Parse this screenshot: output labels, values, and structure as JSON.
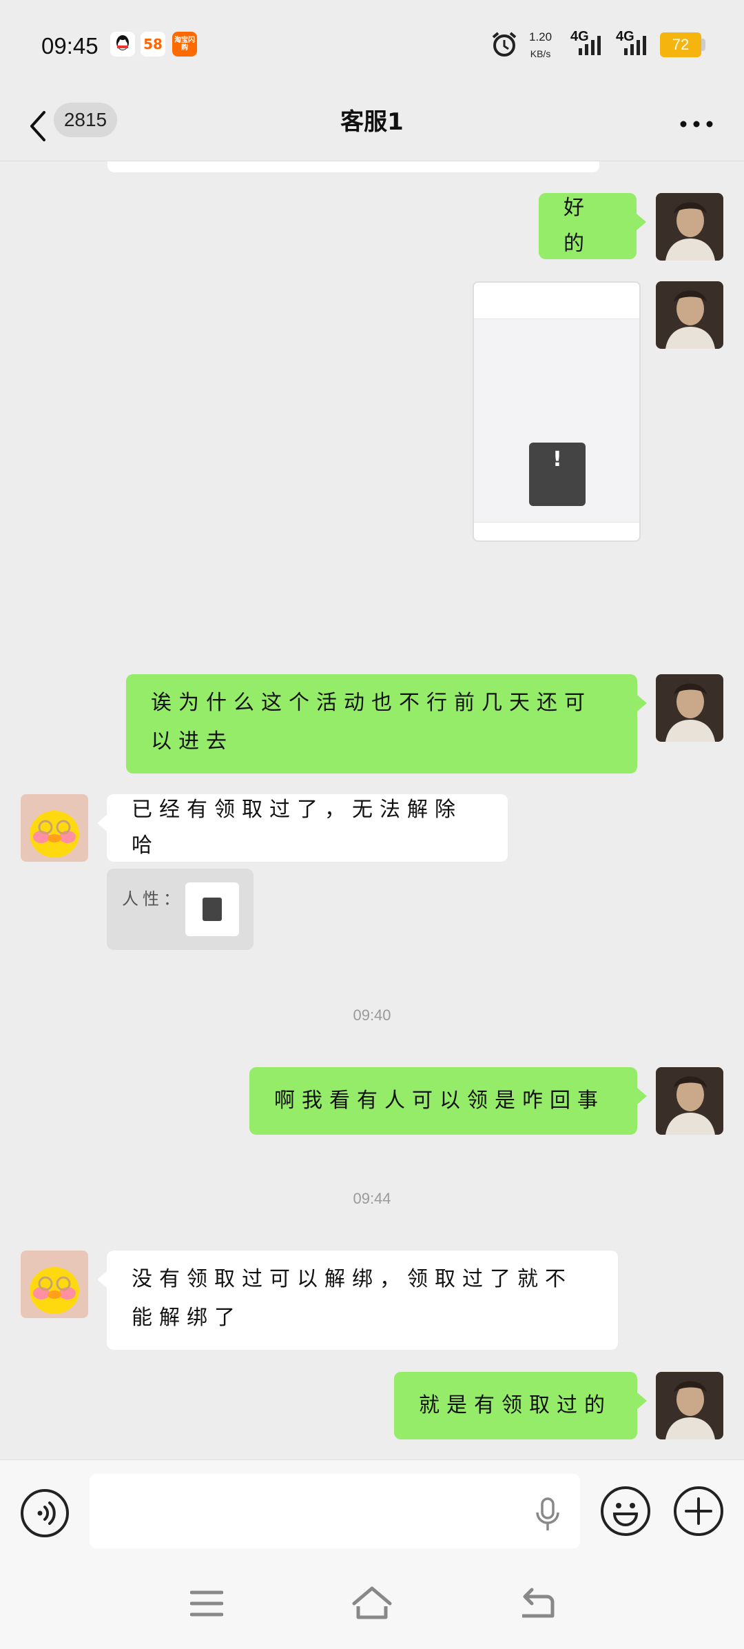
{
  "status": {
    "time": "09:45",
    "apps": [
      "QQ",
      "58",
      "淘宝闪购"
    ],
    "speed_value": "1.20",
    "speed_unit": "KB/s",
    "net1": "4G",
    "net2": "4G",
    "battery": "72"
  },
  "header": {
    "unread_count": "2815",
    "title": "客服1"
  },
  "messages": [
    {
      "side": "right",
      "text": "好的"
    },
    {
      "side": "right",
      "type": "image",
      "label": "!"
    },
    {
      "side": "right",
      "text": "诶为什么这个活动也不行前几天还可以进去"
    },
    {
      "side": "left",
      "text": "已经有领取过了，无法解除哈"
    },
    {
      "side": "left",
      "text": "人性："
    },
    {
      "side": "right",
      "text": "啊我看有人可以领是咋回事"
    },
    {
      "side": "left",
      "text": "没有领取过可以解绑，领取过了就不能解绑了"
    },
    {
      "side": "right",
      "text": "就是有领取过的"
    }
  ],
  "times": [
    "09:40",
    "09:44"
  ],
  "colors": {
    "bubble_self": "#95ec69",
    "bubble_other": "#ffffff",
    "background": "#ededed"
  }
}
